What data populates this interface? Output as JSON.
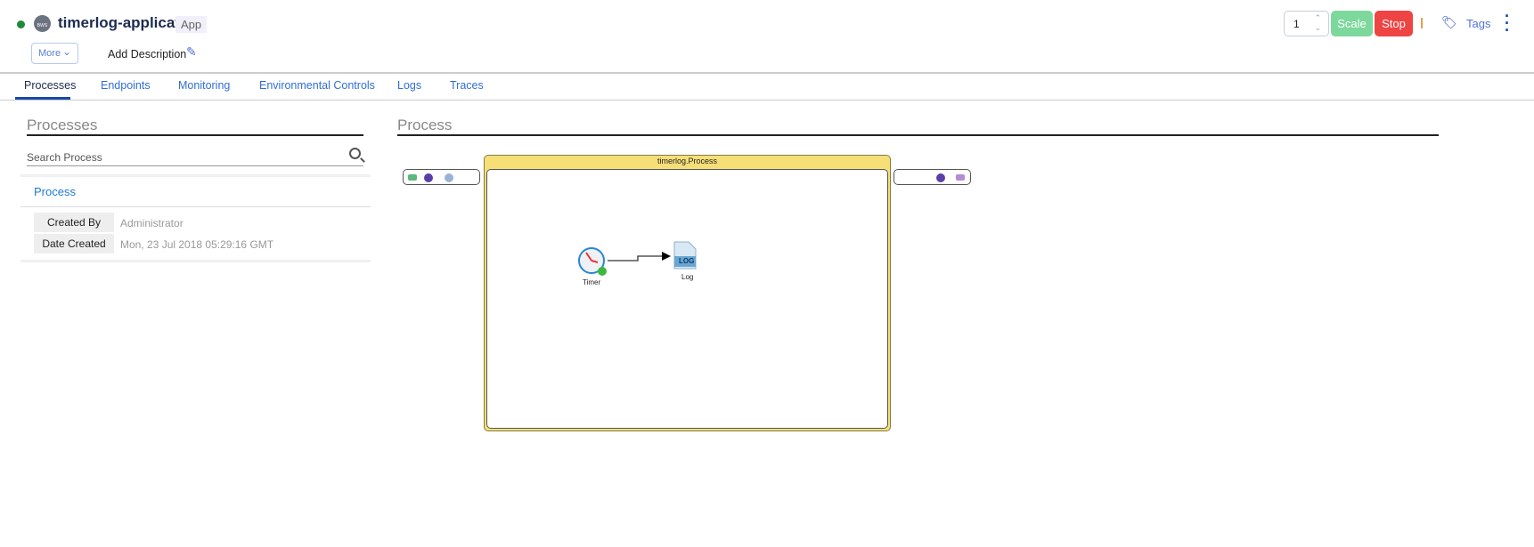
{
  "header": {
    "app_name": "timerlog-application",
    "badge": "App",
    "logo_text": "BWS",
    "more_label": "More",
    "add_description": "Add Description",
    "instances": "1",
    "scale_label": "Scale",
    "stop_label": "Stop",
    "tags_label": "Tags",
    "status_color": "#1f8a3e"
  },
  "tabs": [
    {
      "label": "Processes",
      "active": true
    },
    {
      "label": "Endpoints"
    },
    {
      "label": "Monitoring"
    },
    {
      "label": "Environmental Controls"
    },
    {
      "label": "Logs"
    },
    {
      "label": "Traces"
    }
  ],
  "sidebar": {
    "title": "Processes",
    "search_placeholder": "Search Process",
    "process_name": "Process",
    "details": [
      {
        "label": "Created By",
        "value": "Administrator"
      },
      {
        "label": "Date Created",
        "value": "Mon, 23 Jul 2018 05:29:16 GMT"
      }
    ]
  },
  "diagram": {
    "title": "Process",
    "process_label": "timerlog.Process",
    "nodes": [
      {
        "label": "Timer"
      },
      {
        "label": "Log"
      }
    ],
    "log_icon_text": "LOG"
  }
}
